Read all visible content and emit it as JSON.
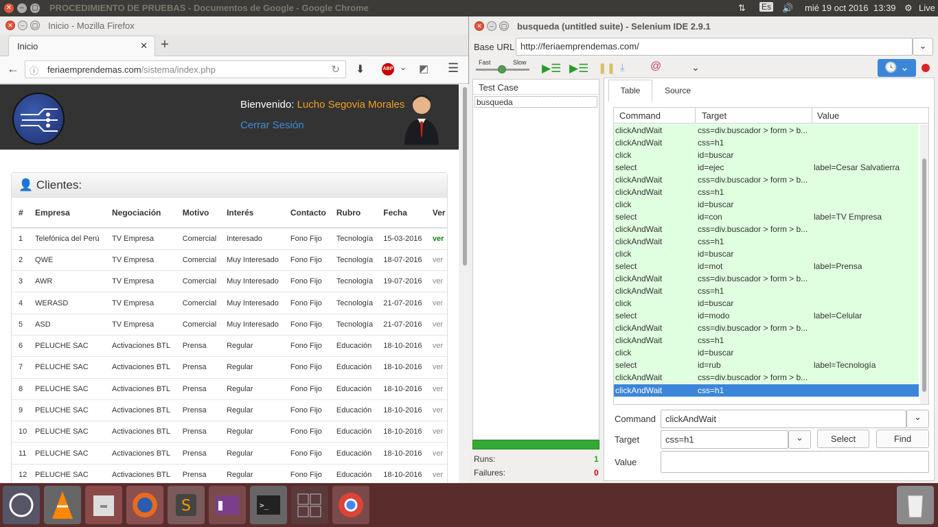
{
  "top_panel": {
    "title": "PROCEDIMIENTO DE PRUEBAS - Documentos de Google - Google Chrome",
    "keyboard": "Es",
    "datetime": "mié 19 oct 2016",
    "time": "13:39",
    "session": "Live"
  },
  "firefox": {
    "window_title": "Inicio - Mozilla Firefox",
    "tab_label": "Inicio",
    "url_host": "feriaemprendemas.com",
    "url_path": "/sistema/index.php",
    "header": {
      "welcome": "Bienvenido:",
      "user": "Lucho Segovia Morales",
      "logout": "Cerrar Sesión"
    },
    "panel_title": "Clientes:",
    "columns": [
      "#",
      "Empresa",
      "Negociación",
      "Motivo",
      "Interés",
      "Contacto",
      "Rubro",
      "Fecha",
      "Ver"
    ],
    "rows": [
      [
        "1",
        "Telefónica del Perú",
        "TV Empresa",
        "Comercial",
        "Interesado",
        "Fono Fijo",
        "Tecnología",
        "15-03-2016",
        "ver"
      ],
      [
        "2",
        "QWE",
        "TV Empresa",
        "Comercial",
        "Muy Interesado",
        "Fono Fijo",
        "Tecnología",
        "18-07-2016",
        "ver"
      ],
      [
        "3",
        "AWR",
        "TV Empresa",
        "Comercial",
        "Muy Interesado",
        "Fono Fijo",
        "Tecnología",
        "19-07-2016",
        "ver"
      ],
      [
        "4",
        "WERASD",
        "TV Empresa",
        "Comercial",
        "Muy Interesado",
        "Fono Fijo",
        "Tecnología",
        "21-07-2016",
        "ver"
      ],
      [
        "5",
        "ASD",
        "TV Empresa",
        "Comercial",
        "Muy Interesado",
        "Fono Fijo",
        "Tecnología",
        "21-07-2016",
        "ver"
      ],
      [
        "6",
        "PELUCHE SAC",
        "Activaciones BTL",
        "Prensa",
        "Regular",
        "Fono Fijo",
        "Educación",
        "18-10-2016",
        "ver"
      ],
      [
        "7",
        "PELUCHE SAC",
        "Activaciones BTL",
        "Prensa",
        "Regular",
        "Fono Fijo",
        "Educación",
        "18-10-2016",
        "ver"
      ],
      [
        "8",
        "PELUCHE SAC",
        "Activaciones BTL",
        "Prensa",
        "Regular",
        "Fono Fijo",
        "Educación",
        "18-10-2016",
        "ver"
      ],
      [
        "9",
        "PELUCHE SAC",
        "Activaciones BTL",
        "Prensa",
        "Regular",
        "Fono Fijo",
        "Educación",
        "18-10-2016",
        "ver"
      ],
      [
        "10",
        "PELUCHE SAC",
        "Activaciones BTL",
        "Prensa",
        "Regular",
        "Fono Fijo",
        "Educación",
        "18-10-2016",
        "ver"
      ],
      [
        "11",
        "PELUCHE SAC",
        "Activaciones BTL",
        "Prensa",
        "Regular",
        "Fono Fijo",
        "Educación",
        "18-10-2016",
        "ver"
      ],
      [
        "12",
        "PELUCHE SAC",
        "Activaciones BTL",
        "Prensa",
        "Regular",
        "Fono Fijo",
        "Educación",
        "18-10-2016",
        "ver"
      ]
    ]
  },
  "selenium": {
    "window_title": "busqueda (untitled suite) - Selenium IDE 2.9.1",
    "base_url_label": "Base URL",
    "base_url": "http://feriaemprendemas.com/",
    "speed_fast": "Fast",
    "speed_slow": "Slow",
    "testcase_header": "Test Case",
    "testcase_item": "busqueda",
    "runs_label": "Runs:",
    "runs": "1",
    "failures_label": "Failures:",
    "failures": "0",
    "tabs": [
      "Table",
      "Source"
    ],
    "grid_headers": [
      "Command",
      "Target",
      "Value"
    ],
    "commands": [
      [
        "clickAndWait",
        "css=div.buscador > form > b...",
        ""
      ],
      [
        "clickAndWait",
        "css=h1",
        ""
      ],
      [
        "click",
        "id=buscar",
        ""
      ],
      [
        "select",
        "id=ejec",
        "label=Cesar Salvatierra"
      ],
      [
        "clickAndWait",
        "css=div.buscador > form > b...",
        ""
      ],
      [
        "clickAndWait",
        "css=h1",
        ""
      ],
      [
        "click",
        "id=buscar",
        ""
      ],
      [
        "select",
        "id=con",
        "label=TV Empresa"
      ],
      [
        "clickAndWait",
        "css=div.buscador > form > b...",
        ""
      ],
      [
        "clickAndWait",
        "css=h1",
        ""
      ],
      [
        "click",
        "id=buscar",
        ""
      ],
      [
        "select",
        "id=mot",
        "label=Prensa"
      ],
      [
        "clickAndWait",
        "css=div.buscador > form > b...",
        ""
      ],
      [
        "clickAndWait",
        "css=h1",
        ""
      ],
      [
        "click",
        "id=buscar",
        ""
      ],
      [
        "select",
        "id=modo",
        "label=Celular"
      ],
      [
        "clickAndWait",
        "css=div.buscador > form > b...",
        ""
      ],
      [
        "clickAndWait",
        "css=h1",
        ""
      ],
      [
        "click",
        "id=buscar",
        ""
      ],
      [
        "select",
        "id=rub",
        "label=Tecnología"
      ],
      [
        "clickAndWait",
        "css=div.buscador > form > b...",
        ""
      ],
      [
        "clickAndWait",
        "css=h1",
        ""
      ]
    ],
    "command_label": "Command",
    "command_value": "clickAndWait",
    "target_label": "Target",
    "target_value": "css=h1",
    "value_label": "Value",
    "value_value": "",
    "select_btn": "Select",
    "find_btn": "Find"
  },
  "dock": [
    "ubuntu-icon",
    "vlc-icon",
    "files-icon",
    "firefox-icon",
    "sublime-icon",
    "app-icon",
    "terminal-icon",
    "workspaces-icon",
    "chrome-icon",
    "trash-icon"
  ]
}
